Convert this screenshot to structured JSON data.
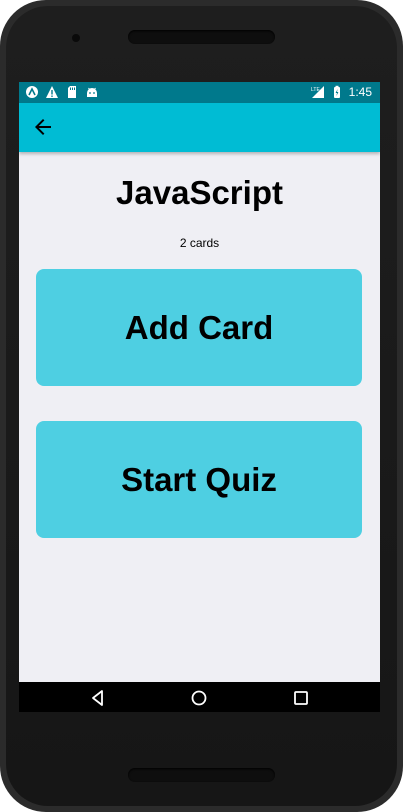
{
  "status_bar": {
    "time": "1:45",
    "left_icons": [
      "app-notification-icon",
      "warning-icon",
      "sd-card-icon",
      "android-icon"
    ],
    "right_icons": [
      "lte-signal-icon",
      "battery-charging-icon"
    ],
    "background_color": "#00798c"
  },
  "app_bar": {
    "back_icon": "arrow-back-icon",
    "background_color": "#00bcd4"
  },
  "deck": {
    "title": "JavaScript",
    "card_count": "2 cards"
  },
  "actions": {
    "add_card_label": "Add Card",
    "start_quiz_label": "Start Quiz",
    "button_color": "#4ecfe2"
  },
  "nav_bar": {
    "icons": [
      "nav-back-icon",
      "nav-home-icon",
      "nav-recent-apps-icon"
    ]
  },
  "screen_background": "#efeff4"
}
